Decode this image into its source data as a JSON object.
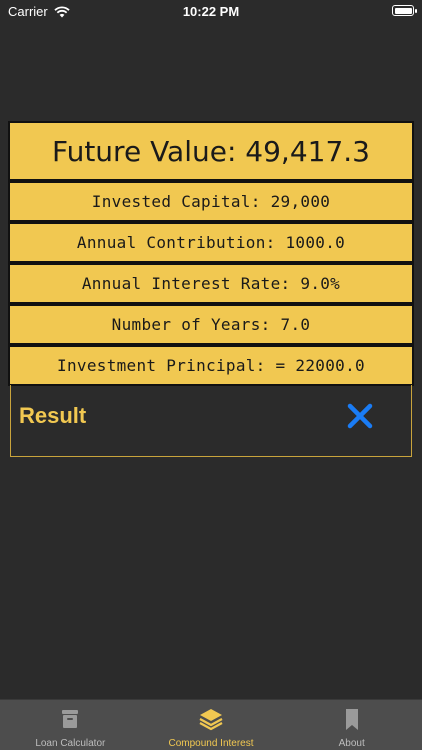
{
  "status_bar": {
    "carrier": "Carrier",
    "time": "10:22 PM"
  },
  "result": {
    "title": "Future Value: 49,417.3",
    "rows": [
      "Invested Capital: 29,000",
      "Annual Contribution: 1000.0",
      "Annual Interest Rate: 9.0%",
      "Number of Years:  7.0",
      "Investment Principal: = 22000.0"
    ],
    "label": "Result"
  },
  "tabs": [
    {
      "label": "Loan Calculator",
      "icon": "archive-box-icon"
    },
    {
      "label": "Compound Interest",
      "icon": "layers-stack-icon"
    },
    {
      "label": "About",
      "icon": "bookmark-icon"
    }
  ],
  "active_tab": 1,
  "colors": {
    "background": "#2b2b2b",
    "accent": "#f1c851",
    "close": "#1a7cf5",
    "tab_bar": "#4d4d4d"
  }
}
